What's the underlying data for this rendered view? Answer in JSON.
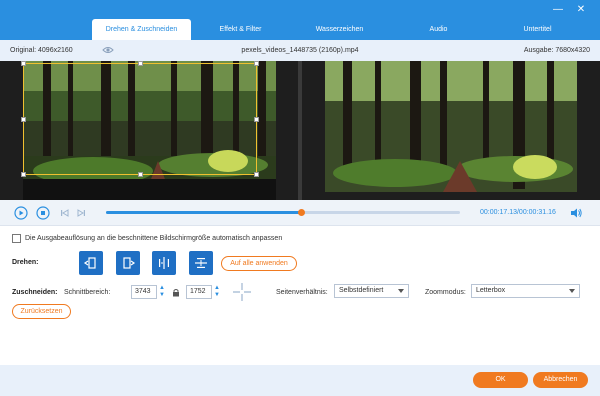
{
  "tabs": [
    {
      "label": "Drehen & Zuschneiden"
    },
    {
      "label": "Effekt & Filter"
    },
    {
      "label": "Wasserzeichen"
    },
    {
      "label": "Audio"
    },
    {
      "label": "Untertitel"
    }
  ],
  "info": {
    "original": "Original: 4096x2160",
    "filename": "pexels_videos_1448735 (2160p).mp4",
    "output": "Ausgabe: 7680x4320"
  },
  "playback": {
    "time": "00:00:17.13/00:00:31.16",
    "progress": 0.55
  },
  "auto_fit_label": "Die Ausgabeauflösung an die beschnittene Bildschirmgröße automatisch anpassen",
  "rotate": {
    "label": "Drehen:",
    "apply_all": "Auf alle anwenden"
  },
  "crop": {
    "label": "Zuschneiden:",
    "area_label": "Schnittbereich:",
    "width": "3743",
    "height": "1752",
    "aspect_label": "Seitenverhältnis:",
    "aspect_value": "Selbstdefiniert",
    "zoom_label": "Zoommodus:",
    "zoom_value": "Letterbox",
    "reset": "Zurücksetzen"
  },
  "footer": {
    "ok": "OK",
    "cancel": "Abbrechen"
  },
  "colors": {
    "accent_blue": "#2a8fe0",
    "accent_orange": "#f07a20",
    "crop_frame": "#f0c030"
  }
}
